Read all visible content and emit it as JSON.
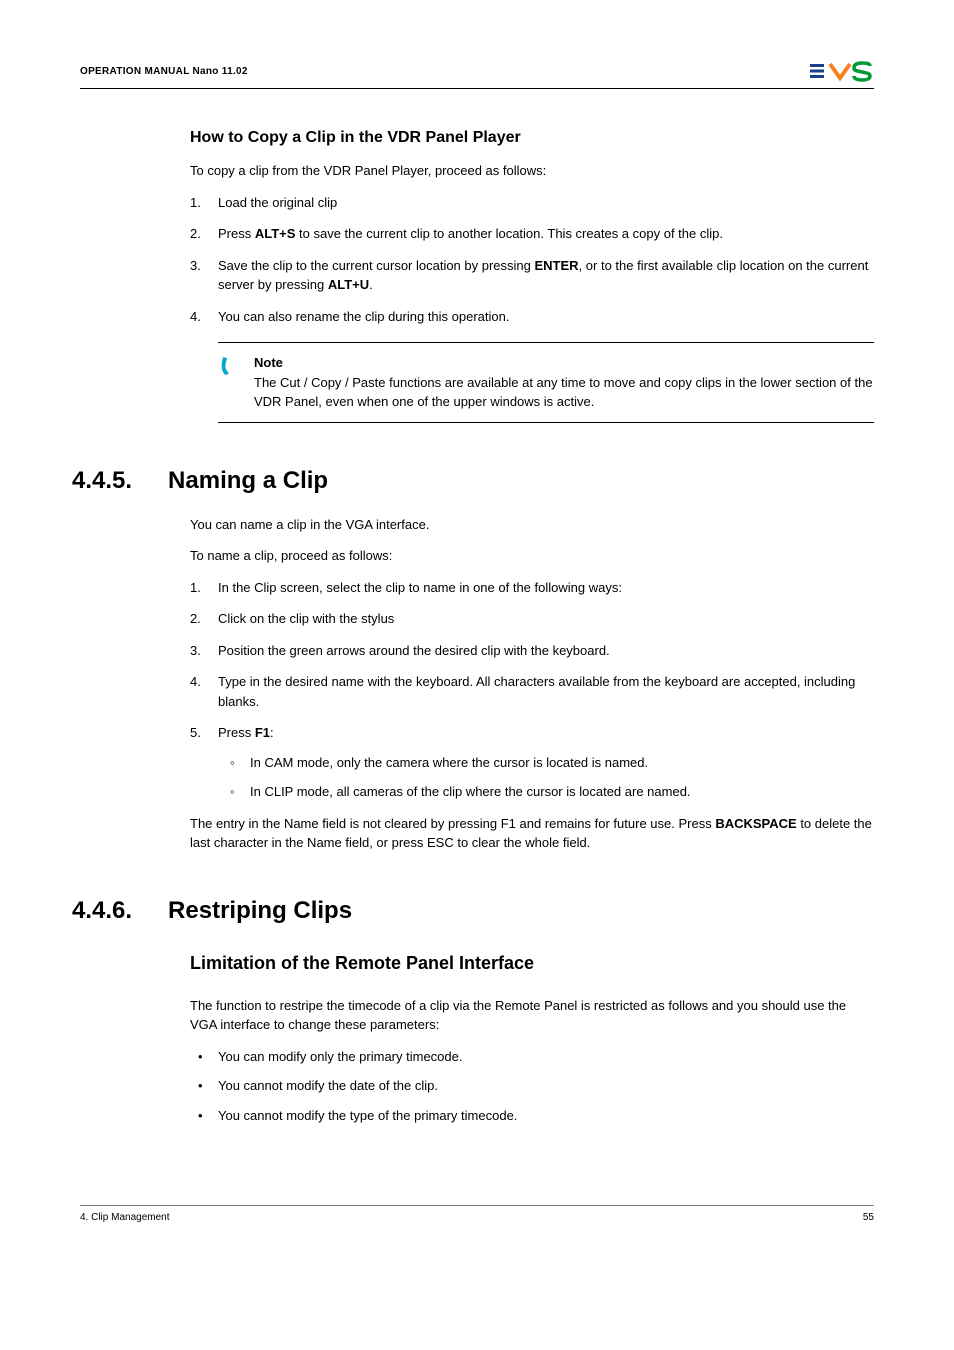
{
  "header": {
    "title": "OPERATION MANUAL Nano 11.02"
  },
  "section1": {
    "title": "How to Copy a Clip in the VDR Panel Player",
    "intro": "To copy a clip from the VDR Panel Player, proceed as follows:",
    "steps": {
      "s1": "Load the original clip",
      "s2a": "Press ",
      "s2b": "ALT+S",
      "s2c": " to save the current clip to another location. This creates a copy of the clip.",
      "s3a": "Save the clip to the current cursor location by pressing ",
      "s3b": "ENTER",
      "s3c": ", or to the first available clip location on the current server by pressing ",
      "s3d": "ALT+U",
      "s3e": ".",
      "s4": "You can also rename the clip during this operation."
    },
    "note": {
      "label": "Note",
      "text": "The Cut / Copy / Paste functions are available at any time to move and copy clips in the lower section of the VDR Panel, even when one of the upper windows is active."
    }
  },
  "section2": {
    "number": "4.4.5.",
    "title": "Naming a Clip",
    "intro1": "You can name a clip in the VGA interface.",
    "intro2": "To name a clip, proceed as follows:",
    "steps": {
      "s1": "In the Clip screen, select the clip to name in one of the following ways:",
      "s2": "Click on the clip with the stylus",
      "s3": "Position the green arrows around the desired clip with the keyboard.",
      "s4": "Type in the desired name with the keyboard. All characters available from the keyboard are accepted, including blanks.",
      "s5a": "Press ",
      "s5b": "F1",
      "s5c": ":",
      "sub1": "In CAM mode, only the camera where the cursor is located is named.",
      "sub2": "In CLIP mode, all cameras of the clip where the cursor is located are named."
    },
    "outro_a": "The entry in the Name field is not cleared by pressing F1 and remains for future use. Press ",
    "outro_b": "BACKSPACE",
    "outro_c": " to delete the last character in the Name field, or press ESC to clear the whole field."
  },
  "section3": {
    "number": "4.4.6.",
    "title": "Restriping Clips",
    "subheading": "Limitation of the Remote Panel Interface",
    "intro": "The function to restripe the timecode of a clip via the Remote Panel is restricted as follows and you should use the VGA interface to change these parameters:",
    "bullets": {
      "b1": "You can modify only the primary timecode.",
      "b2": "You cannot modify the date of the clip.",
      "b3": "You cannot modify the type of the primary timecode."
    }
  },
  "footer": {
    "left": "4. Clip Management",
    "right": "55"
  }
}
